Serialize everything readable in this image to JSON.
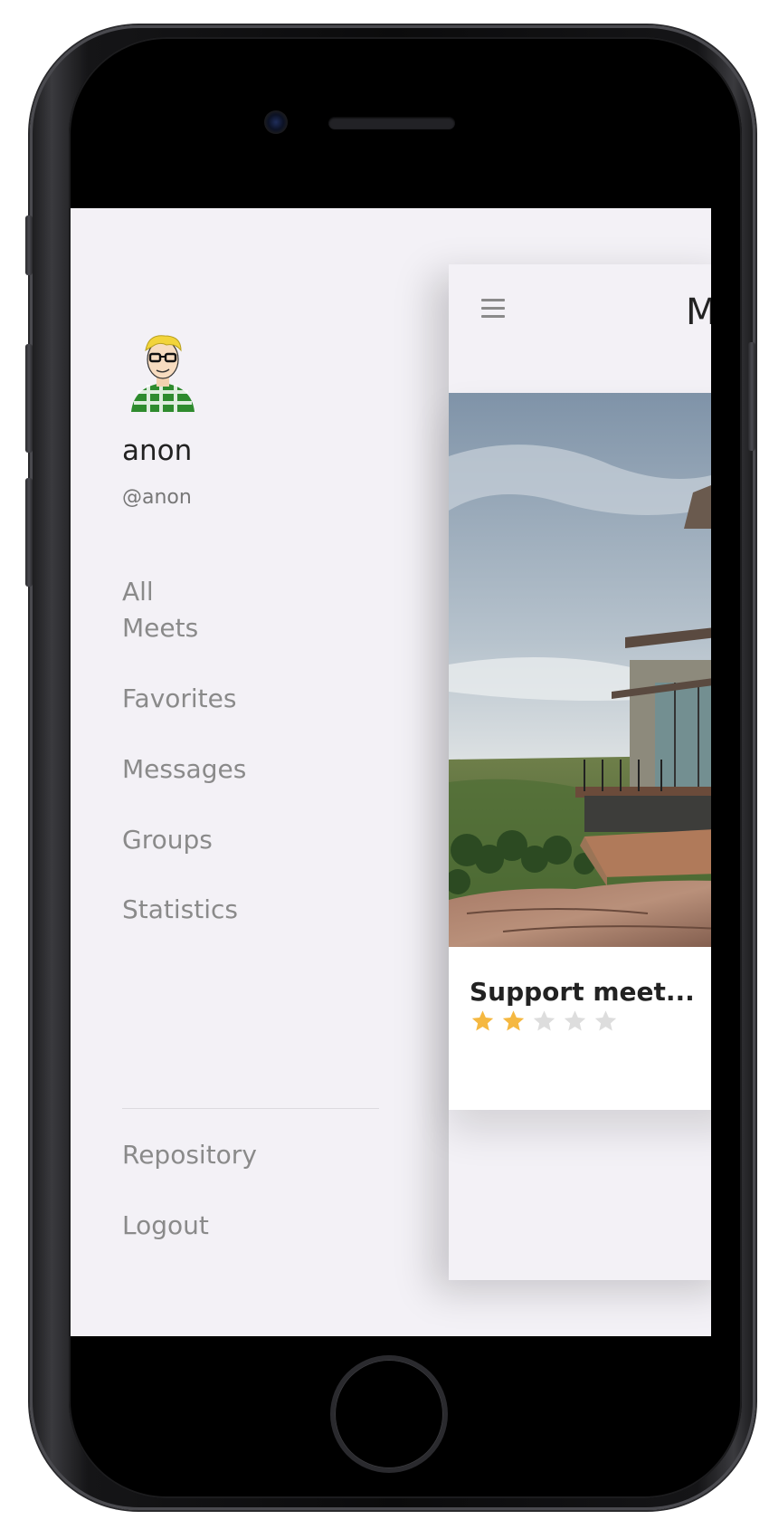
{
  "user": {
    "name": "anon",
    "handle": "@anon"
  },
  "nav": {
    "items": [
      {
        "label": "All\nMeets"
      },
      {
        "label": "Favorites"
      },
      {
        "label": "Messages"
      },
      {
        "label": "Groups"
      },
      {
        "label": "Statistics"
      }
    ],
    "footer": [
      {
        "label": "Repository"
      },
      {
        "label": "Logout"
      }
    ]
  },
  "main": {
    "title_partial": "M",
    "menu_icon": "hamburger-menu-icon",
    "card": {
      "title": "Support meet...",
      "rating": 2,
      "rating_max": 5
    }
  },
  "colors": {
    "star_filled": "#f5b841",
    "star_empty": "#dddddd",
    "drawer_bg": "#f3f1f6",
    "nav_text": "#8a8a8a"
  }
}
